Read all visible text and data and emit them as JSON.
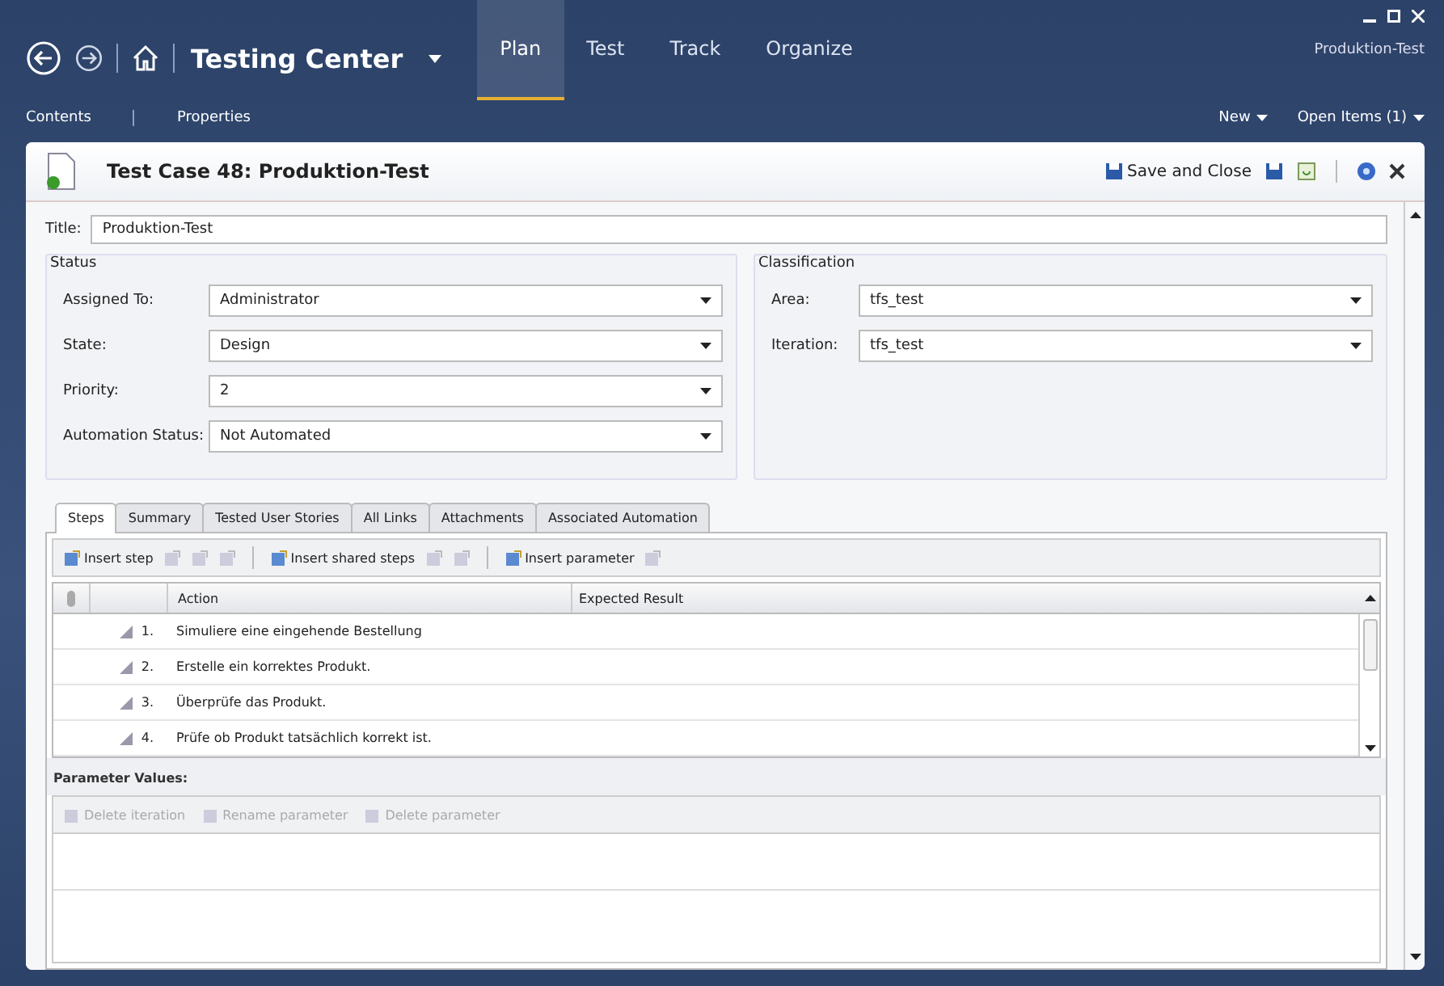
{
  "app": {
    "title": "Testing Center",
    "nav": [
      {
        "label": "Plan",
        "selected": true
      },
      {
        "label": "Test",
        "selected": false
      },
      {
        "label": "Track",
        "selected": false
      },
      {
        "label": "Organize",
        "selected": false
      }
    ],
    "project": "Produktion-Test"
  },
  "subbar": {
    "left": [
      "Contents",
      "Properties"
    ],
    "right": [
      "New",
      "Open Items (1)"
    ]
  },
  "work_item": {
    "title": "Test Case 48: Produktion-Test",
    "save_and_close": "Save and Close"
  },
  "title_field": {
    "label": "Title:",
    "value": "Produktion-Test"
  },
  "status": {
    "heading": "Status",
    "fields": [
      {
        "label": "Assigned To:",
        "value": "Administrator"
      },
      {
        "label": "State:",
        "value": "Design"
      },
      {
        "label": "Priority:",
        "value": "2"
      },
      {
        "label": "Automation Status:",
        "value": "Not Automated"
      }
    ]
  },
  "classification": {
    "heading": "Classification",
    "fields": [
      {
        "label": "Area:",
        "value": "tfs_test"
      },
      {
        "label": "Iteration:",
        "value": "tfs_test"
      }
    ]
  },
  "tabs": [
    {
      "label": "Steps",
      "selected": true
    },
    {
      "label": "Summary",
      "selected": false
    },
    {
      "label": "Tested User Stories",
      "selected": false
    },
    {
      "label": "All Links",
      "selected": false
    },
    {
      "label": "Attachments",
      "selected": false
    },
    {
      "label": "Associated Automation",
      "selected": false
    }
  ],
  "steps_toolbar": [
    {
      "label": "Insert step",
      "disabled": false
    },
    {
      "disabled": true
    },
    {
      "disabled": true
    },
    {
      "disabled": true
    },
    {
      "label": "Insert shared steps",
      "disabled": false
    },
    {
      "disabled": true
    },
    {
      "disabled": true
    },
    {
      "label": "Insert parameter",
      "disabled": false
    },
    {
      "disabled": true
    }
  ],
  "steps_table": {
    "columns": [
      "Action",
      "Expected Result"
    ],
    "rows": [
      {
        "number": "1.",
        "action": "Simuliere eine eingehende Bestellung"
      },
      {
        "number": "2.",
        "action": "Erstelle ein korrektes Produkt."
      },
      {
        "number": "3.",
        "action": "Überprüfe das Produkt."
      },
      {
        "number": "4.",
        "action": "Prüfe ob Produkt tatsächlich korrekt ist."
      }
    ]
  },
  "parameters": {
    "heading": "Parameter Values:",
    "toolbar": [
      {
        "label": "Delete iteration",
        "disabled": true
      },
      {
        "label": "Rename parameter",
        "disabled": true
      },
      {
        "label": "Delete parameter",
        "disabled": true
      }
    ]
  }
}
